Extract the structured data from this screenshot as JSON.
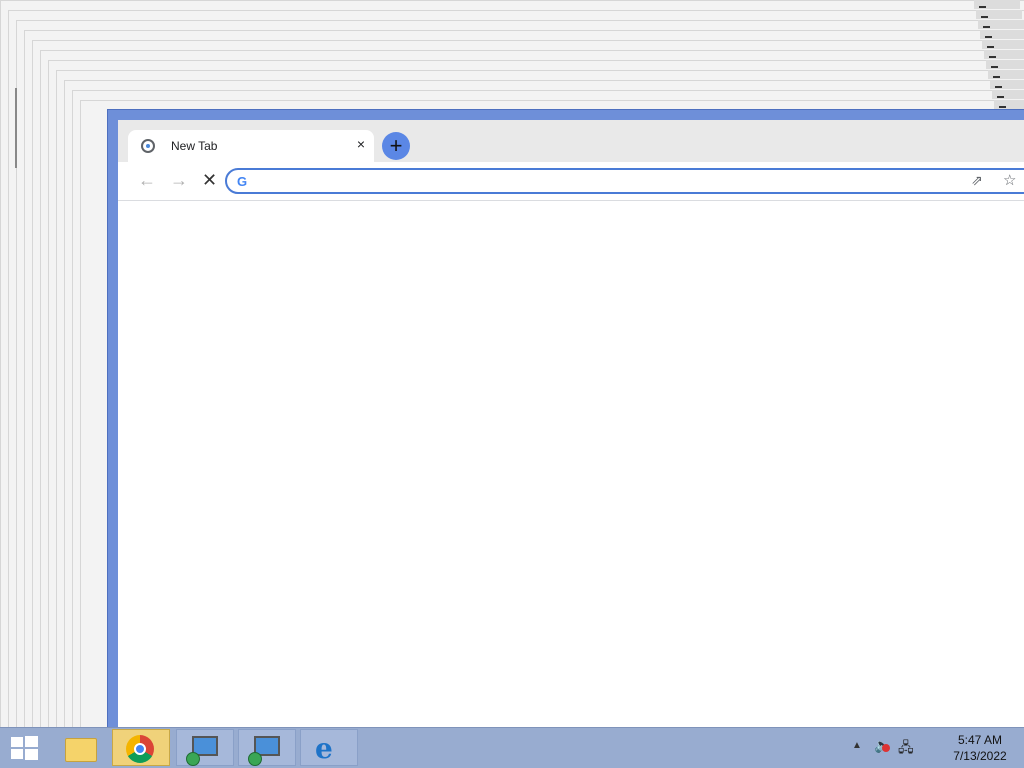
{
  "browser": {
    "tab": {
      "title": "New Tab",
      "close_label": "×"
    },
    "new_tab_label": "+",
    "nav": {
      "back": "←",
      "forward": "→",
      "stop": "✕"
    },
    "omnibox": {
      "value": "",
      "placeholder": "",
      "g_label": "G"
    },
    "icons": {
      "share": "⇗",
      "bookmark": "☆"
    }
  },
  "taskbar": {
    "items": [
      {
        "name": "file-explorer-icon"
      },
      {
        "name": "chrome-icon"
      },
      {
        "name": "remote-desktop-icon"
      },
      {
        "name": "remote-desktop-icon"
      },
      {
        "name": "internet-explorer-icon"
      }
    ],
    "ie_glyph": "e",
    "tray": {
      "arrow": "▲",
      "volume": "🔈",
      "network": "🖧"
    },
    "clock": {
      "time": "5:47 AM",
      "date": "7/13/2022"
    }
  },
  "colors": {
    "accent": "#6e8fd9",
    "taskbar": "#98acd0"
  }
}
